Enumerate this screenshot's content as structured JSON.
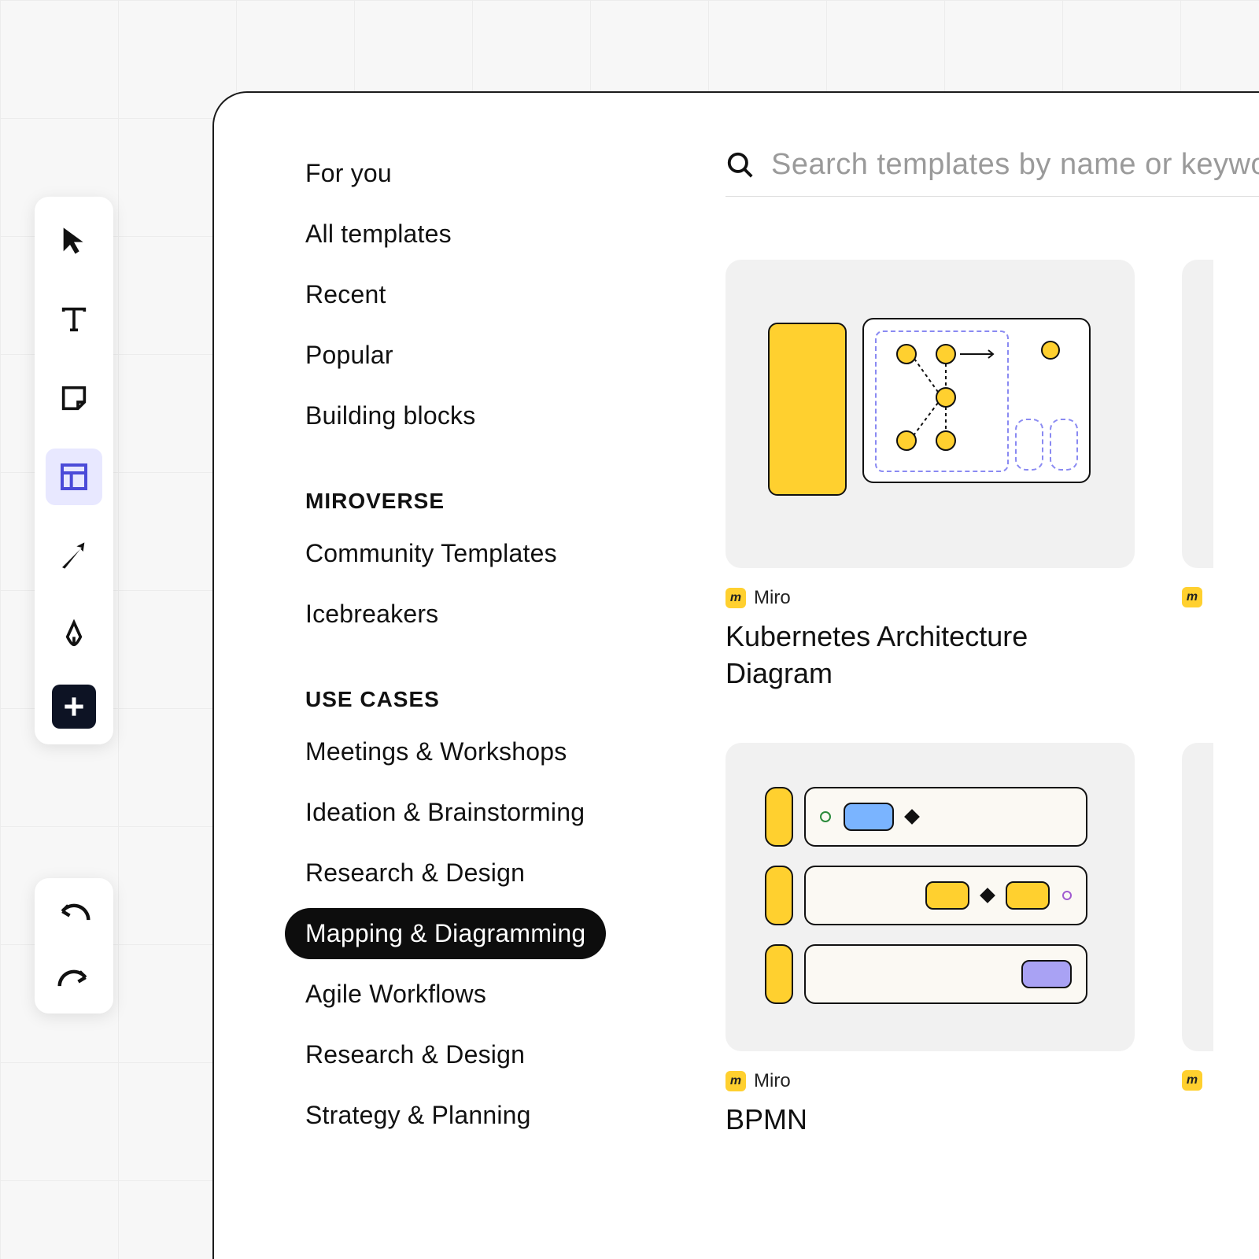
{
  "search": {
    "placeholder": "Search templates by name or keyword"
  },
  "sidebar": {
    "top": [
      {
        "label": "For  you"
      },
      {
        "label": "All templates"
      },
      {
        "label": "Recent"
      },
      {
        "label": "Popular"
      },
      {
        "label": "Building blocks"
      }
    ],
    "miroverse_title": "MIROVERSE",
    "miroverse": [
      {
        "label": "Community Templates"
      },
      {
        "label": "Icebreakers"
      }
    ],
    "usecases_title": "USE CASES",
    "usecases": [
      {
        "label": "Meetings & Workshops",
        "active": false
      },
      {
        "label": "Ideation & Brainstorming",
        "active": false
      },
      {
        "label": "Research & Design",
        "active": false
      },
      {
        "label": "Mapping & Diagramming",
        "active": true
      },
      {
        "label": "Agile Workflows",
        "active": false
      },
      {
        "label": "Research & Design",
        "active": false
      },
      {
        "label": "Strategy & Planning",
        "active": false
      }
    ]
  },
  "cards": [
    {
      "author": "Miro",
      "title": "Kubernetes Architecture Diagram"
    },
    {
      "author": "Miro",
      "title": "BPMN"
    }
  ],
  "toolbar": {
    "tools": [
      {
        "name": "cursor-icon"
      },
      {
        "name": "text-icon"
      },
      {
        "name": "sticky-note-icon"
      },
      {
        "name": "templates-icon",
        "active": true
      },
      {
        "name": "arrow-icon"
      },
      {
        "name": "pen-icon"
      },
      {
        "name": "add-icon"
      }
    ]
  },
  "colors": {
    "accent": "#ffd02f",
    "active_bg": "#e8e8ff",
    "active_stroke": "#4b4bd8"
  }
}
